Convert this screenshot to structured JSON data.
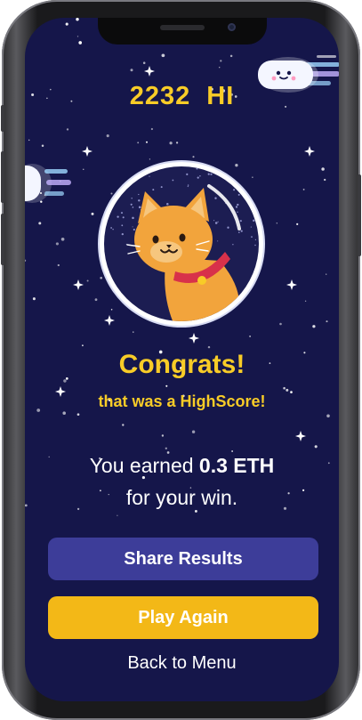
{
  "game": {
    "score": "2232",
    "score_label": "HI"
  },
  "result": {
    "title": "Congrats!",
    "subtitle": "that was a HighScore!",
    "earned_prefix": "You earned",
    "earned_amount": "0.3 ETH",
    "earned_suffix": "for your win."
  },
  "actions": {
    "share_label": "Share Results",
    "play_again_label": "Play Again",
    "back_label": "Back to Menu"
  },
  "colors": {
    "background": "#15164a",
    "accent_yellow": "#f8cc27",
    "share_button": "#3d3d99",
    "play_button": "#f3b817"
  },
  "icons": {
    "character": "astronaut-cat-icon",
    "comet": "comet-icon"
  }
}
